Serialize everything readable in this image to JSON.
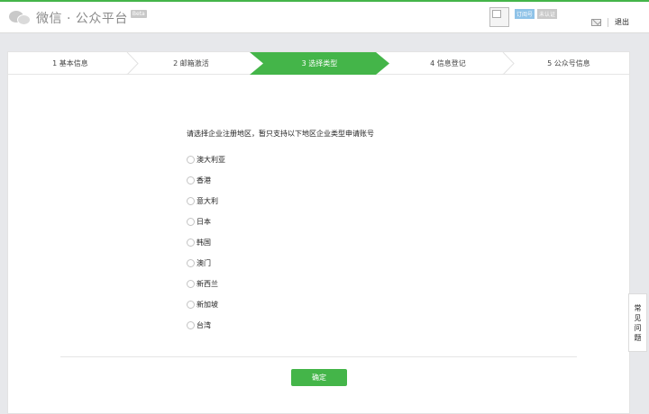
{
  "header": {
    "brand": "微信 · 公众平台",
    "beta_badge": "Beta",
    "account_name": "订阅号",
    "account_status": "未认证",
    "logout": "退出"
  },
  "steps": [
    {
      "label": "1 基本信息",
      "active": false
    },
    {
      "label": "2 邮箱激活",
      "active": false
    },
    {
      "label": "3 选择类型",
      "active": true
    },
    {
      "label": "4 信息登记",
      "active": false
    },
    {
      "label": "5 公众号信息",
      "active": false
    }
  ],
  "form": {
    "question": "请选择企业注册地区，暂只支持以下地区企业类型申请账号",
    "options": [
      "澳大利亚",
      "香港",
      "意大利",
      "日本",
      "韩国",
      "澳门",
      "新西兰",
      "新加坡",
      "台湾"
    ],
    "submit_label": "确定"
  },
  "faq": {
    "chars": [
      "常",
      "见",
      "问",
      "题"
    ]
  },
  "colors": {
    "accent": "#44b549",
    "background": "#e7e8eb"
  }
}
